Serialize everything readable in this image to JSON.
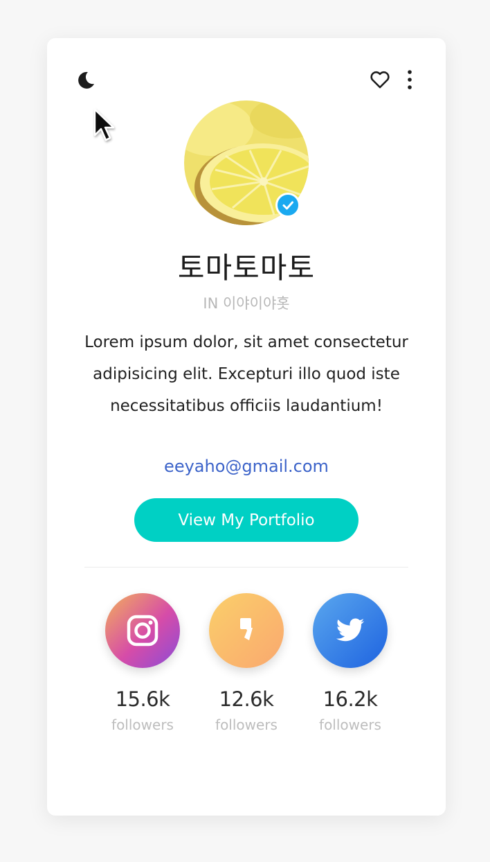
{
  "header": {
    "theme_icon": "moon-icon",
    "favorite_icon": "heart-icon",
    "menu_icon": "more-vertical-icon"
  },
  "profile": {
    "name": "토마토마토",
    "company": "IN 이야이야홋",
    "verified": true,
    "bio": "Lorem ipsum dolor, sit amet consectetur adipisicing elit. Excepturi illo quod iste necessitatibus officiis laudantium!",
    "email": "eeyaho@gmail.com",
    "button_label": "View My Portfolio"
  },
  "socials": [
    {
      "icon": "instagram-icon",
      "count": "15.6k",
      "label": "followers"
    },
    {
      "icon": "quote-icon",
      "count": "12.6k",
      "label": "followers"
    },
    {
      "icon": "twitter-icon",
      "count": "16.2k",
      "label": "followers"
    }
  ],
  "colors": {
    "accent": "#00d0c4",
    "link": "#3c63c9",
    "verified": "#1aa9f0"
  }
}
